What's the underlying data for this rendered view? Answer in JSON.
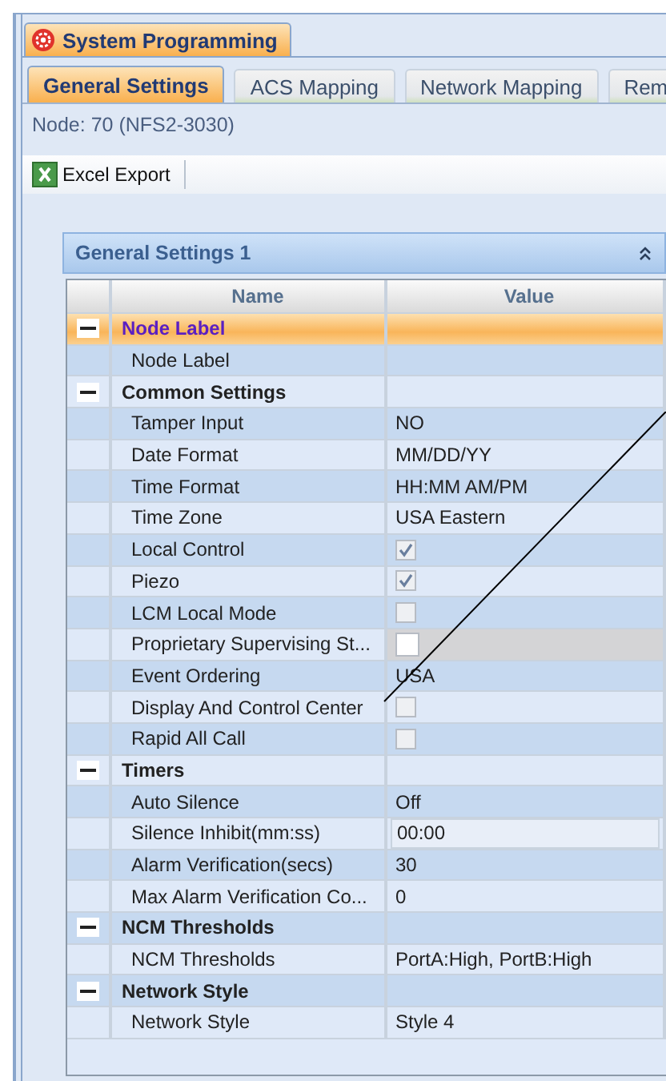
{
  "window": {
    "title": "System Programming"
  },
  "tabs": [
    {
      "label": "General Settings",
      "selected": true
    },
    {
      "label": "ACS Mapping",
      "selected": false
    },
    {
      "label": "Network Mapping",
      "selected": false
    },
    {
      "label": "Rem",
      "selected": false
    }
  ],
  "node": "Node: 70 (NFS2-3030)",
  "toolbar": [
    {
      "label": "Excel Export"
    }
  ],
  "panel": {
    "title": "General Settings 1",
    "expanded": true,
    "columns": [
      "Name",
      "Value"
    ],
    "groups": [
      {
        "label": "Node Label",
        "expanded": true,
        "selected": true,
        "children": [
          {
            "name": "Node Label",
            "kind": "text",
            "disabled": false
          }
        ]
      },
      {
        "label": "Common Settings",
        "expanded": true,
        "selected": false,
        "children": [
          {
            "name": "Tamper Input",
            "kind": "text",
            "value": "NO",
            "disabled": false
          },
          {
            "name": "Date Format",
            "kind": "text",
            "value": "MM/DD/YY",
            "disabled": false
          },
          {
            "name": "Time Format",
            "kind": "text",
            "value": "HH:MM AM/PM",
            "disabled": false
          },
          {
            "name": "Time Zone",
            "kind": "text",
            "value": "USA Eastern",
            "disabled": false
          },
          {
            "name": "Local Control",
            "kind": "checkbox",
            "checked": true,
            "disabled": false
          },
          {
            "name": "Piezo",
            "kind": "checkbox",
            "checked": true,
            "disabled": false
          },
          {
            "name": "LCM Local Mode",
            "kind": "checkbox",
            "checked": false,
            "disabled": false
          },
          {
            "name": "Proprietary Supervising St...",
            "kind": "checkbox",
            "checked": false,
            "disabled": true
          },
          {
            "name": "Event Ordering",
            "kind": "text",
            "value": "USA",
            "disabled": false
          },
          {
            "name": "Display And Control Center",
            "kind": "checkbox",
            "checked": false,
            "disabled": false
          },
          {
            "name": "Rapid All Call",
            "kind": "checkbox",
            "checked": false,
            "disabled": false
          }
        ]
      },
      {
        "label": "Timers",
        "expanded": true,
        "selected": false,
        "children": [
          {
            "name": "Auto Silence",
            "kind": "text",
            "value": "Off",
            "disabled": false
          },
          {
            "name": "Silence Inhibit(mm:ss)",
            "kind": "field",
            "value": "00:00",
            "disabled": false
          },
          {
            "name": "Alarm Verification(secs)",
            "kind": "text",
            "value": "30",
            "disabled": false
          },
          {
            "name": "Max Alarm Verification Co...",
            "kind": "text",
            "value": "0",
            "disabled": false
          }
        ]
      },
      {
        "label": "NCM Thresholds",
        "expanded": true,
        "selected": false,
        "children": [
          {
            "name": "NCM Thresholds",
            "kind": "text",
            "value": "PortA:High, PortB:High",
            "disabled": false
          }
        ]
      },
      {
        "label": "Network Style",
        "expanded": true,
        "selected": false,
        "children": [
          {
            "name": "Network Style",
            "kind": "text",
            "value": "Style 4",
            "disabled": false
          }
        ]
      }
    ]
  }
}
